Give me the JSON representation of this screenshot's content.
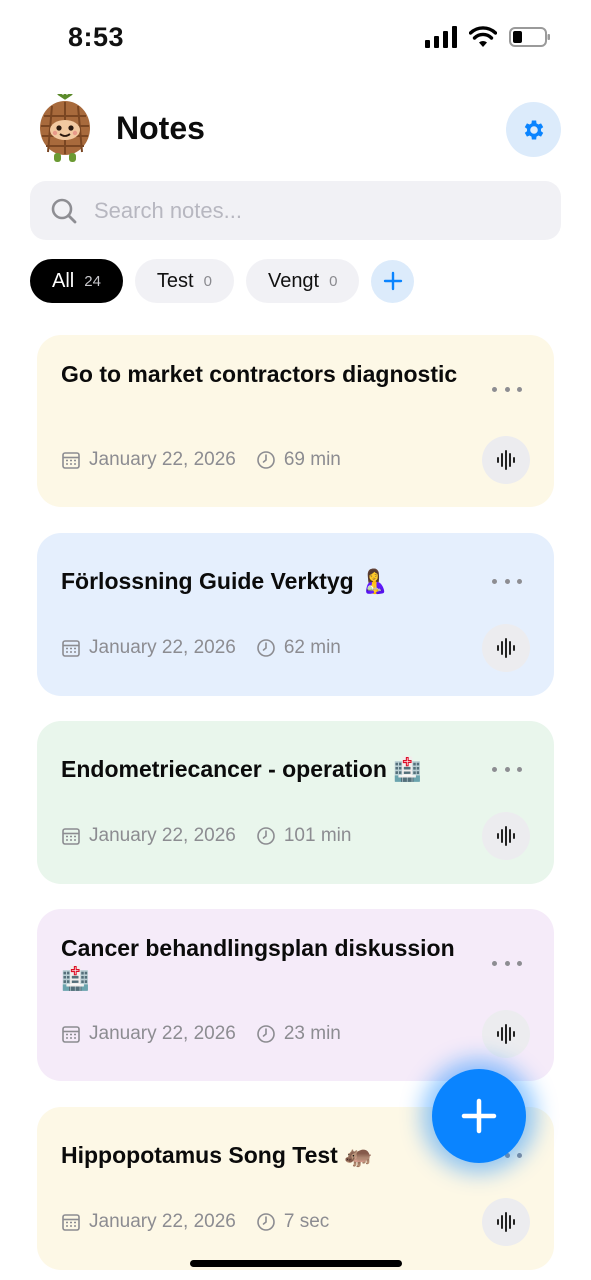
{
  "status_bar": {
    "time": "8:53"
  },
  "header": {
    "title": "Notes"
  },
  "search": {
    "placeholder": "Search notes..."
  },
  "filters": [
    {
      "label": "All",
      "count": "24",
      "active": true
    },
    {
      "label": "Test",
      "count": "0",
      "active": false
    },
    {
      "label": "Vengt",
      "count": "0",
      "active": false
    }
  ],
  "notes": [
    {
      "title": "Go to market contractors diagnostic",
      "date": "January 22, 2026",
      "duration": "69 min",
      "color": "#fdf8e6"
    },
    {
      "title": "Förlossning Guide Verktyg 🤱",
      "date": "January 22, 2026",
      "duration": "62 min",
      "color": "#e5effd"
    },
    {
      "title": "Endometriecancer - operation 🏥",
      "date": "January 22, 2026",
      "duration": "101 min",
      "color": "#e9f6ec"
    },
    {
      "title": "Cancer behandlingsplan diskussion 🏥",
      "date": "January 22, 2026",
      "duration": "23 min",
      "color": "#f5ebf9"
    },
    {
      "title": "Hippopotamus Song Test 🦛",
      "date": "January 22, 2026",
      "duration": "7 sec",
      "color": "#fdf8e6"
    }
  ],
  "colors": {
    "accent": "#0a84ff",
    "chip_active": "#000000"
  }
}
